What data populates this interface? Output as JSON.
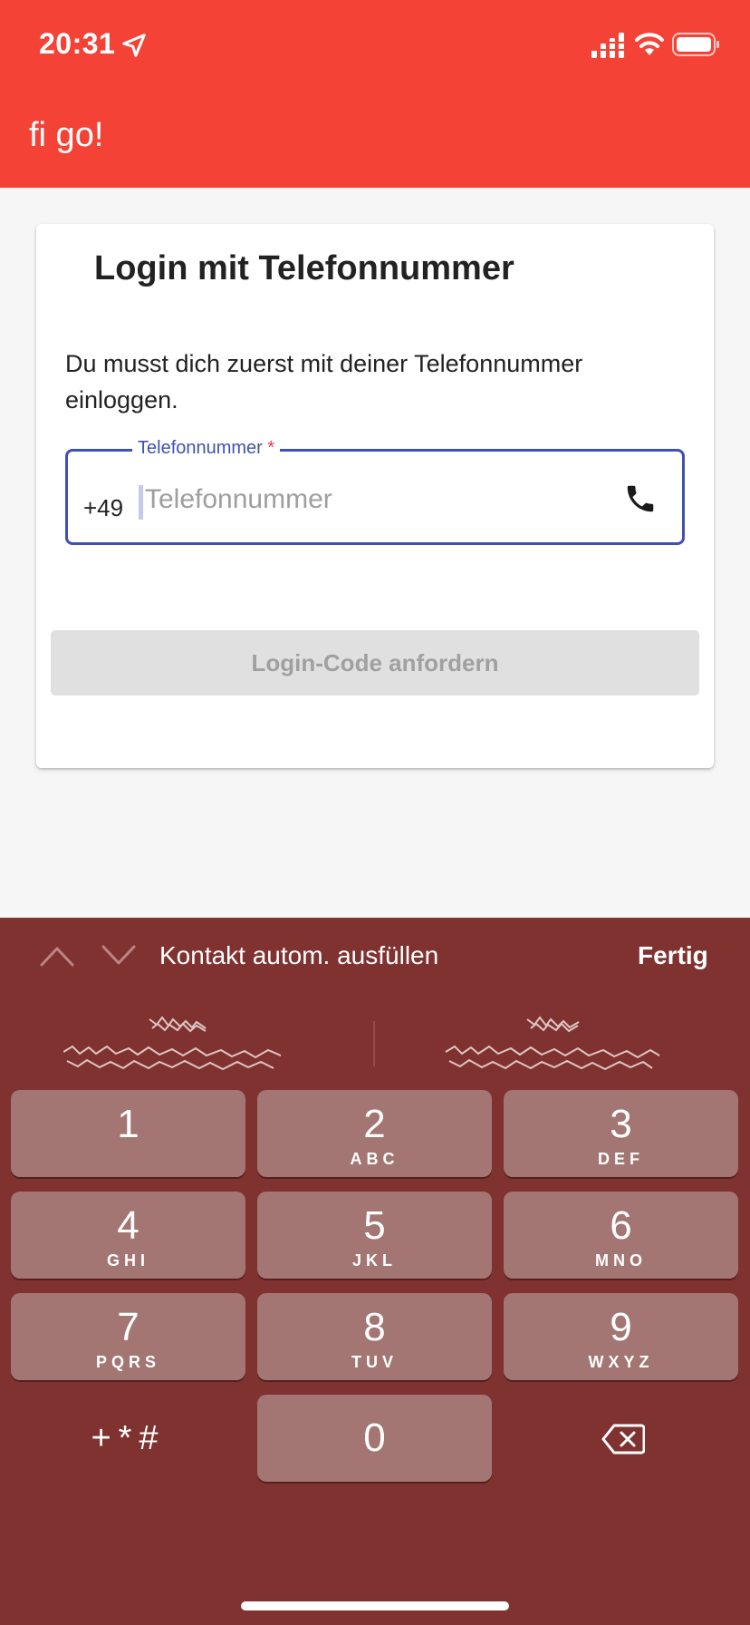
{
  "status_bar": {
    "time": "20:31"
  },
  "app_bar": {
    "title": "fi go!"
  },
  "card": {
    "title": "Login mit Telefonnummer",
    "description": "Du musst dich zuerst mit deiner Telefonnummer einloggen.",
    "phone_field": {
      "label": "Telefonnummer",
      "required_marker": "*",
      "prefix": "+49",
      "placeholder": "Telefonnummer",
      "value": ""
    },
    "submit_label": "Login-Code anfordern"
  },
  "keyboard": {
    "accessory": {
      "autofill_label": "Kontakt autom. ausfüllen",
      "done_label": "Fertig"
    },
    "keys": [
      {
        "num": "1",
        "letters": ""
      },
      {
        "num": "2",
        "letters": "ABC"
      },
      {
        "num": "3",
        "letters": "DEF"
      },
      {
        "num": "4",
        "letters": "GHI"
      },
      {
        "num": "5",
        "letters": "JKL"
      },
      {
        "num": "6",
        "letters": "MNO"
      },
      {
        "num": "7",
        "letters": "PQRS"
      },
      {
        "num": "8",
        "letters": "TUV"
      },
      {
        "num": "9",
        "letters": "WXYZ"
      },
      {
        "num": "0",
        "letters": ""
      }
    ],
    "symbols_label": "+*#"
  },
  "colors": {
    "app_bar": "#f44336",
    "accent": "#3f51b5",
    "required": "#e53950",
    "keyboard_bg": "#803230",
    "key_bg": "#a37673"
  }
}
